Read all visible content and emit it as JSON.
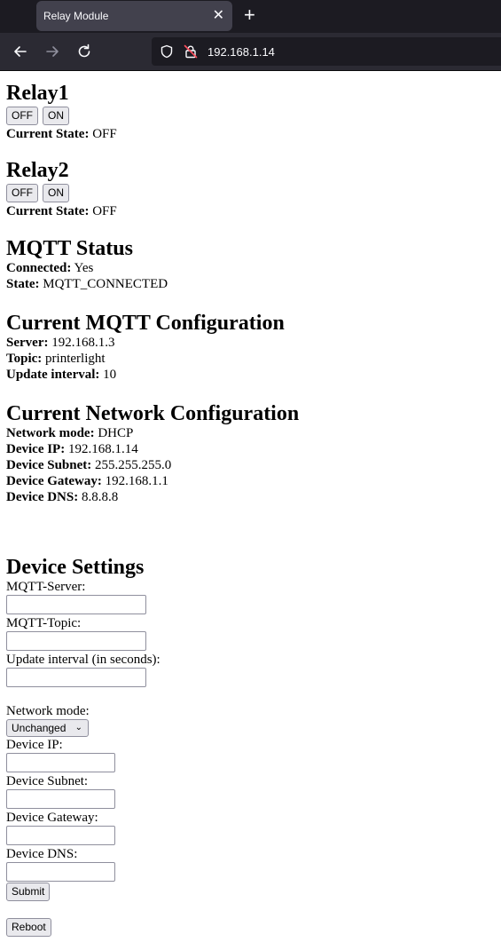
{
  "browser": {
    "tab_title": "Relay Module",
    "tab_close": "✕",
    "new_tab": "+",
    "url": "192.168.1.14"
  },
  "relay1": {
    "heading": "Relay1",
    "off_label": "OFF",
    "on_label": "ON",
    "state_label": "Current State:",
    "state_value": "OFF"
  },
  "relay2": {
    "heading": "Relay2",
    "off_label": "OFF",
    "on_label": "ON",
    "state_label": "Current State:",
    "state_value": "OFF"
  },
  "mqtt_status": {
    "heading": "MQTT Status",
    "connected_label": "Connected:",
    "connected_value": "Yes",
    "state_label": "State:",
    "state_value": "MQTT_CONNECTED"
  },
  "mqtt_config": {
    "heading": "Current MQTT Configuration",
    "server_label": "Server:",
    "server_value": "192.168.1.3",
    "topic_label": "Topic:",
    "topic_value": "printerlight",
    "interval_label": "Update interval:",
    "interval_value": "10"
  },
  "network_config": {
    "heading": "Current Network Configuration",
    "mode_label": "Network mode:",
    "mode_value": "DHCP",
    "ip_label": "Device IP:",
    "ip_value": "192.168.1.14",
    "subnet_label": "Device Subnet:",
    "subnet_value": "255.255.255.0",
    "gateway_label": "Device Gateway:",
    "gateway_value": "192.168.1.1",
    "dns_label": "Device DNS:",
    "dns_value": "8.8.8.8"
  },
  "settings": {
    "heading": "Device Settings",
    "mqtt_server_label": "MQTT-Server:",
    "mqtt_topic_label": "MQTT-Topic:",
    "interval_label": "Update interval (in seconds):",
    "network_mode_label": "Network mode:",
    "network_mode_selected": "Unchanged",
    "device_ip_label": "Device IP:",
    "device_subnet_label": "Device Subnet:",
    "device_gateway_label": "Device Gateway:",
    "device_dns_label": "Device DNS:",
    "submit_label": "Submit",
    "reboot_label": "Reboot"
  },
  "colors": {
    "tabbar_bg": "#1c1b22",
    "navbar_bg": "#2b2a33",
    "button_bg": "#e9e9ed"
  }
}
